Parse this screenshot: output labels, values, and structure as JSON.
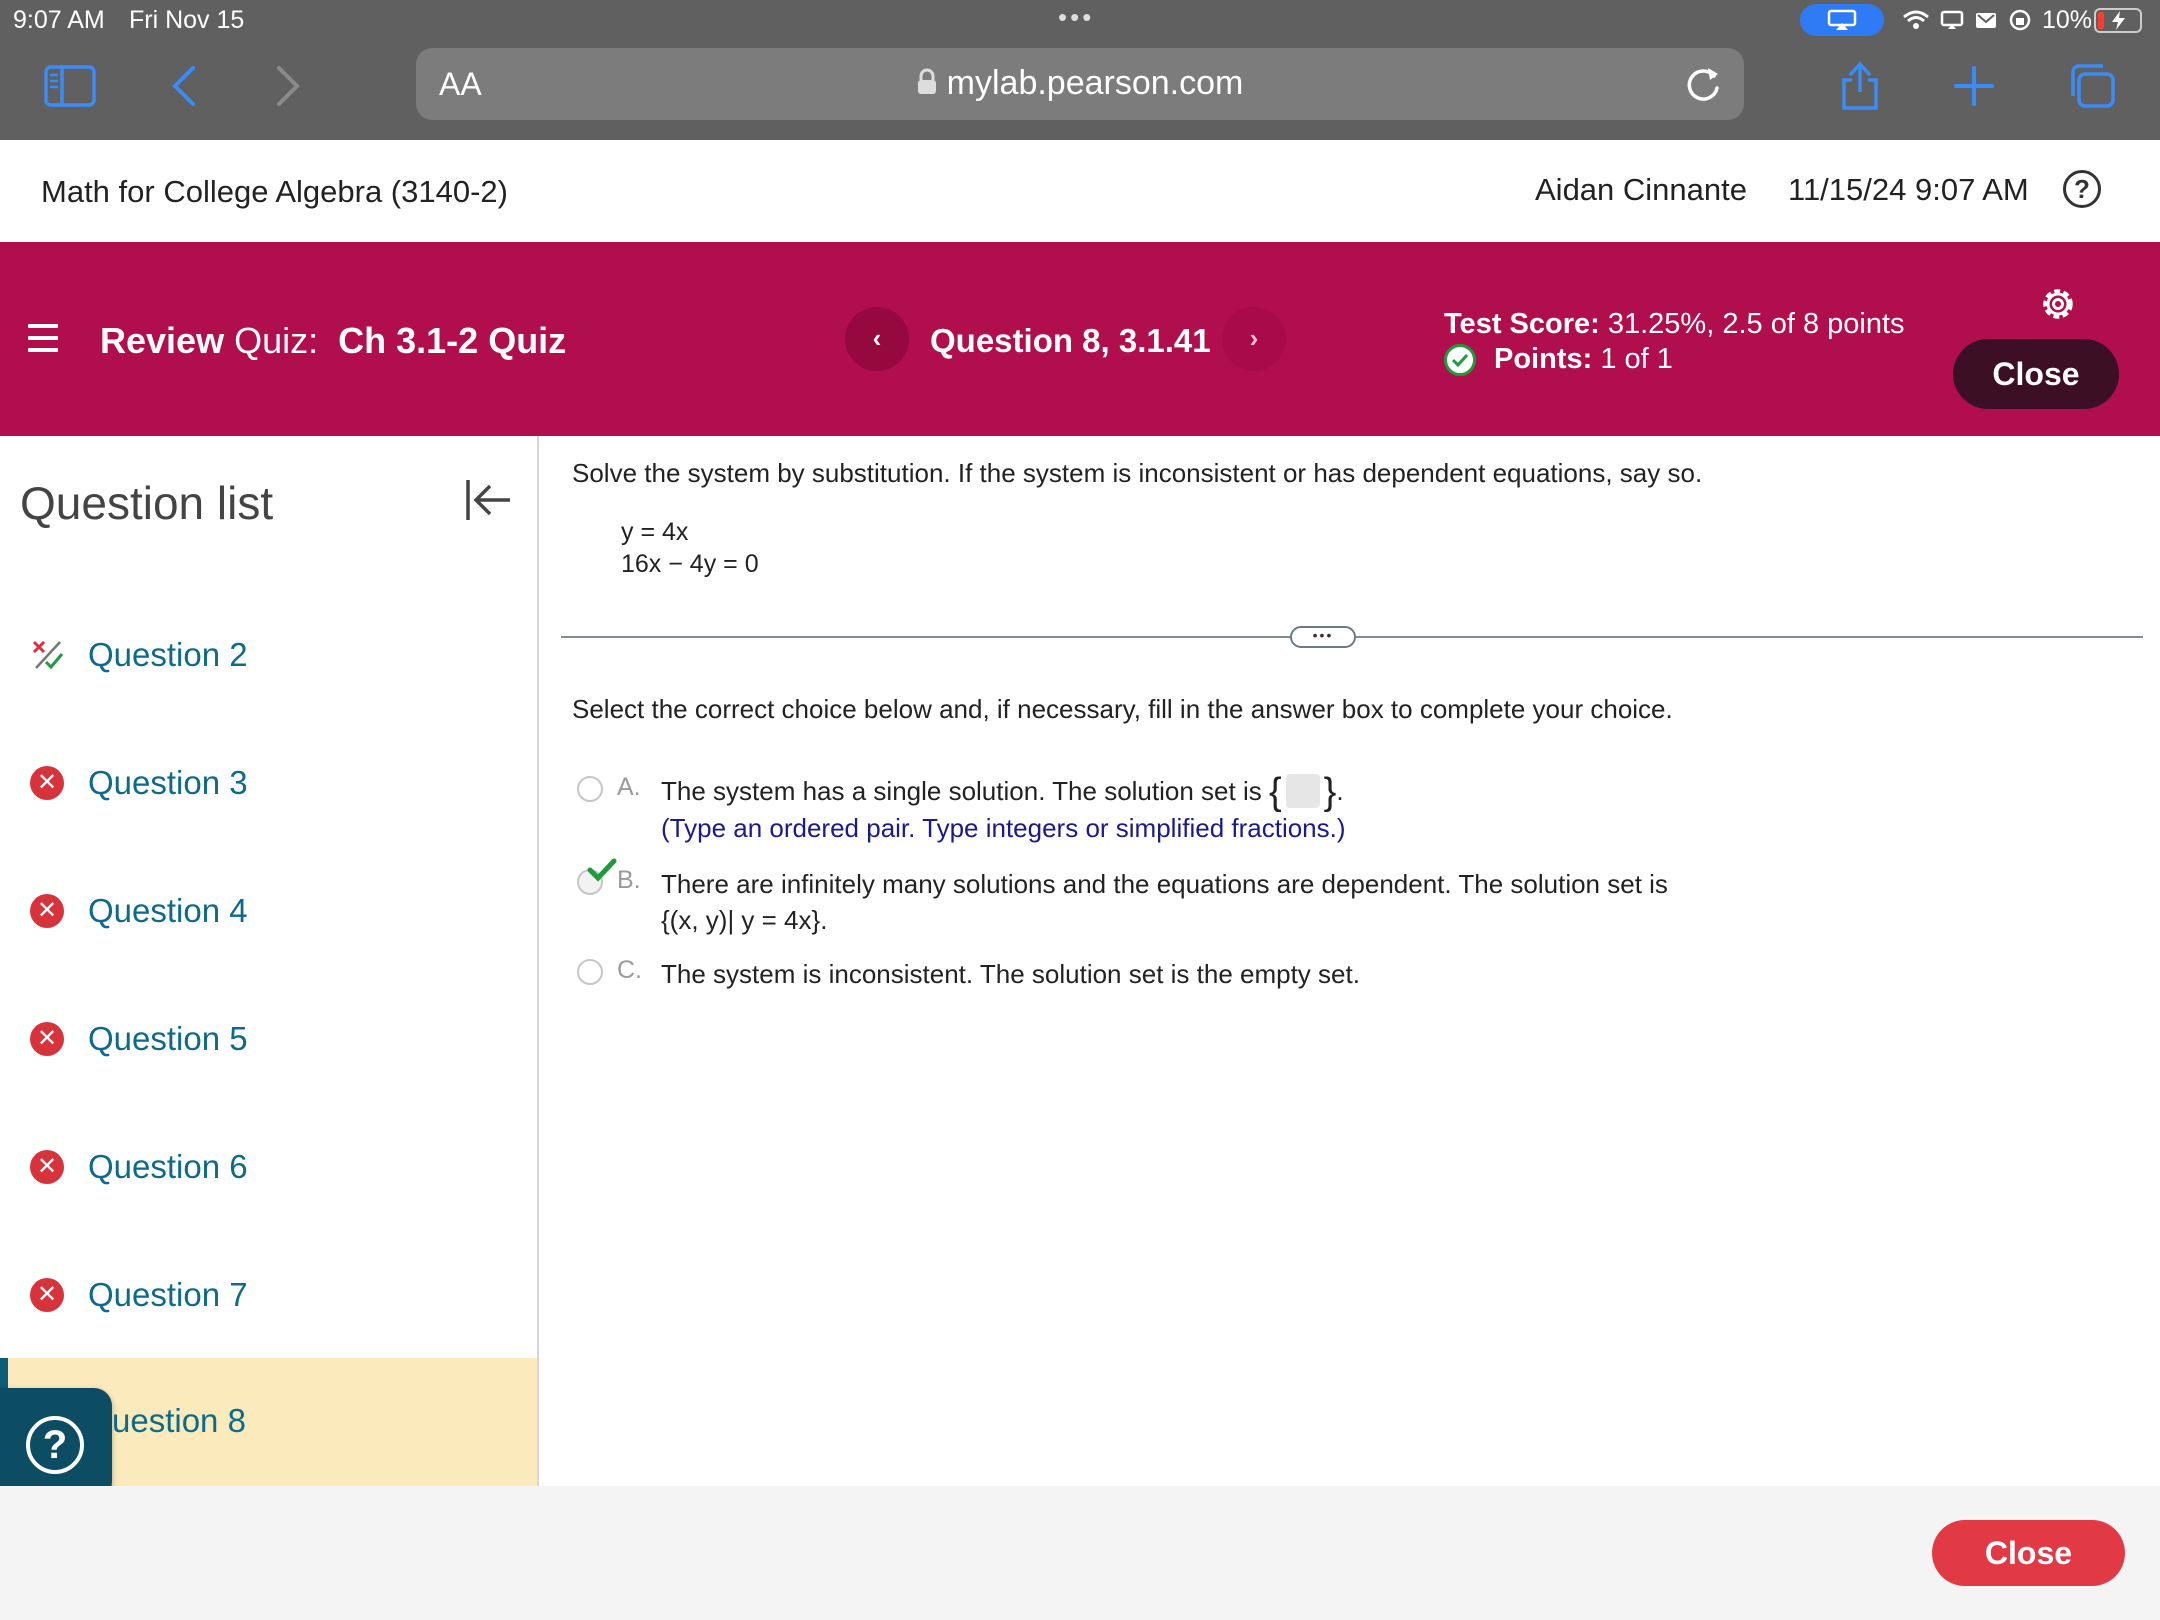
{
  "status_bar": {
    "time": "9:07 AM",
    "date": "Fri Nov 15",
    "battery": "10%"
  },
  "browser": {
    "text_size_label": "AA",
    "url": "mylab.pearson.com"
  },
  "course": {
    "title": "Math for College Algebra (3140-2)",
    "user": "Aidan Cinnante",
    "datetime": "11/15/24 9:07 AM"
  },
  "quiz": {
    "review_label": "Review",
    "quiz_label": "Quiz:",
    "quiz_name": "Ch 3.1-2 Quiz",
    "question": "Question 8, 3.1.41",
    "prev_symbol": "‹",
    "next_symbol": "›",
    "score_label": "Test Score:",
    "score_value": "31.25%, 2.5 of 8 points",
    "points_label": "Points:",
    "points_value": "1 of 1",
    "close_label": "Close"
  },
  "sidebar": {
    "title": "Question list",
    "items": [
      {
        "label": "Question 2",
        "status": "partial"
      },
      {
        "label": "Question 3",
        "status": "incorrect"
      },
      {
        "label": "Question 4",
        "status": "incorrect"
      },
      {
        "label": "Question 5",
        "status": "incorrect"
      },
      {
        "label": "Question 6",
        "status": "incorrect"
      },
      {
        "label": "Question 7",
        "status": "incorrect"
      },
      {
        "label": "uestion 8",
        "status": "current"
      }
    ]
  },
  "problem": {
    "instructions": "Solve the system by substitution. If the system is inconsistent or has dependent equations, say so.",
    "equation_1": "y = 4x",
    "equation_2": "16x − 4y = 0",
    "select_instructions": "Select the correct choice below and, if necessary, fill in the answer box to complete your choice.",
    "choices": [
      {
        "letter": "A.",
        "text": "The system has a single solution. The solution set is",
        "suffix": ".",
        "hint": "(Type an ordered pair. Type integers or simplified fractions.)",
        "selected": false
      },
      {
        "letter": "B.",
        "text": "There are infinitely many solutions and the equations are dependent. The solution set is",
        "line2": "{(x, y)| y = 4x}.",
        "selected": true,
        "correct": true
      },
      {
        "letter": "C.",
        "text": "The system is inconsistent. The solution set is the empty set.",
        "selected": false
      }
    ]
  },
  "footer": {
    "close_label": "Close"
  },
  "colors": {
    "banner": "#b00e4c",
    "link": "#0d6a89",
    "incorrect": "#d6333b",
    "correct": "#1f9a3c",
    "current_row": "#fbeabc",
    "footer_close": "#e23a45"
  }
}
